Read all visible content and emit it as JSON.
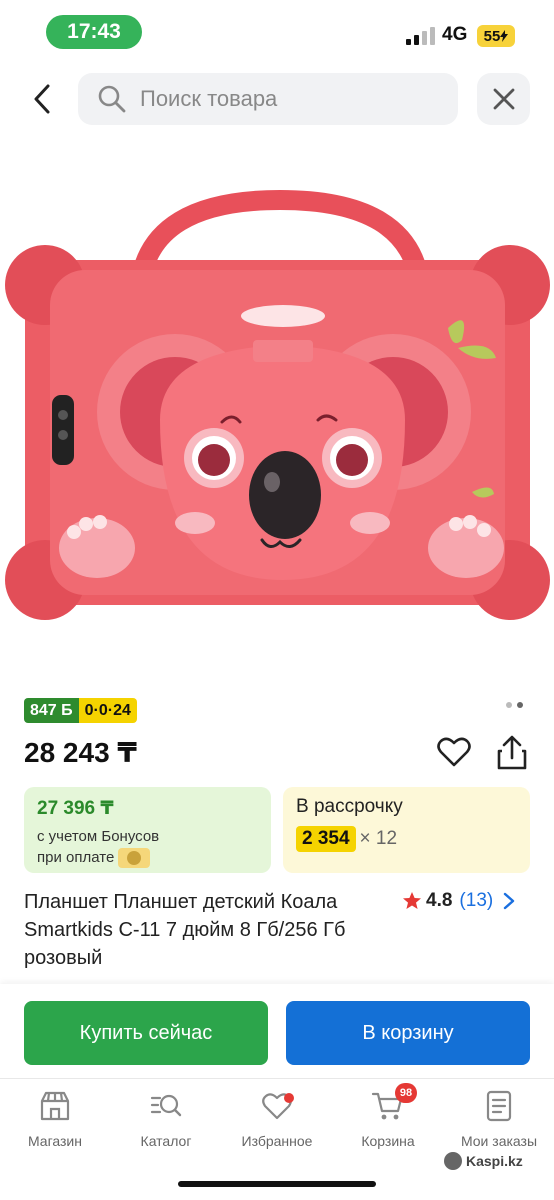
{
  "status_bar": {
    "time": "17:43",
    "network": "4G",
    "battery": "55"
  },
  "search": {
    "placeholder": "Поиск товара"
  },
  "product": {
    "bonus_badge": "847 Б",
    "installment_badge": "0·0·24",
    "price": "28 243 ₸",
    "bonus_price": "27 396 ₸",
    "bonus_note_line1": "с учетом Бонусов",
    "bonus_note_line2": "при оплате",
    "installment_title": "В рассрочку",
    "installment_amount": "2 354",
    "installment_months": "× 12",
    "title": "Планшет Планшет детский Коала Smartkids C-11 7 дюйм 8 Гб/256 Гб розовый",
    "rating": "4.8",
    "review_count": "(13)"
  },
  "image_pagination": {
    "current": 2,
    "total": 2
  },
  "actions": {
    "buy_now": "Купить сейчас",
    "add_to_cart": "В корзину"
  },
  "tabs": [
    {
      "label": "Магазин",
      "icon": "shop-icon"
    },
    {
      "label": "Каталог",
      "icon": "catalog-search-icon"
    },
    {
      "label": "Избранное",
      "icon": "heart-icon"
    },
    {
      "label": "Корзина",
      "icon": "cart-icon"
    },
    {
      "label": "Мои заказы",
      "icon": "orders-icon"
    }
  ],
  "cart_count": "98",
  "watermark": "Kaspi.kz",
  "colors": {
    "green": "#2ca54b",
    "blue": "#1470d6",
    "yellow": "#f5d300",
    "red": "#e53935",
    "tablet_pink": "#ec5d65"
  }
}
